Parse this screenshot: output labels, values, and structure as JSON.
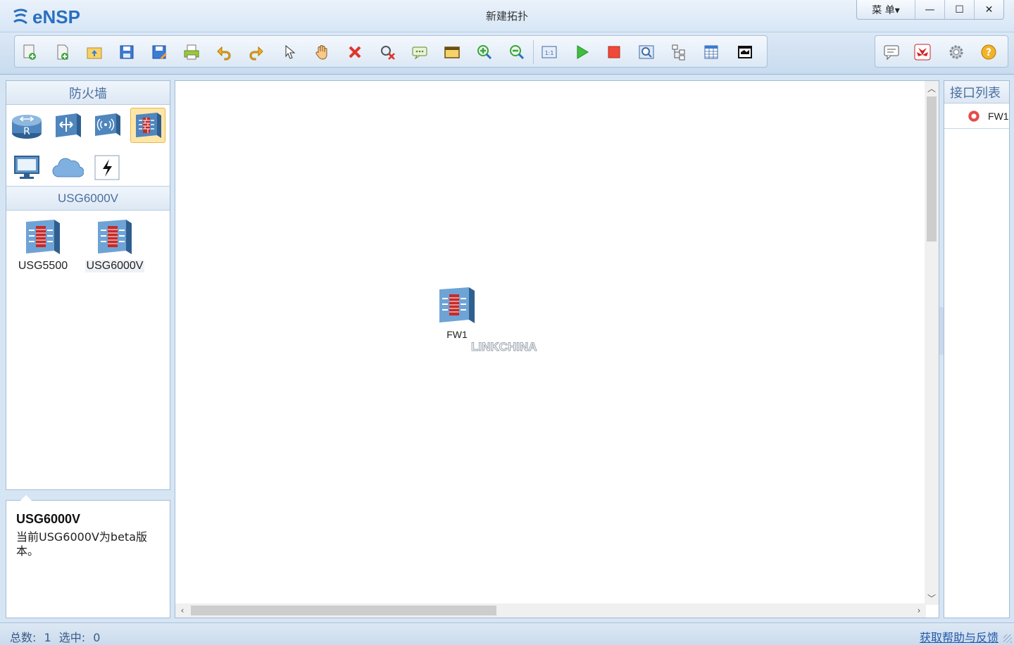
{
  "app": {
    "logo_text": "eNSP",
    "window_title": "新建拓扑"
  },
  "window_controls": {
    "menu_label": "菜 单▾",
    "minimize": "—",
    "maximize": "☐",
    "close": "✕"
  },
  "toolbar": {
    "buttons": [
      "new-topology-icon",
      "new-blank-icon",
      "open-icon",
      "save-icon",
      "save-as-icon",
      "print-icon",
      "undo-icon",
      "redo-icon",
      "select-pointer-icon",
      "pan-hand-icon",
      "delete-icon",
      "delete-link-icon",
      "add-text-icon",
      "palette-icon",
      "zoom-in-icon",
      "zoom-out-icon",
      "fit-view-icon",
      "start-device-icon",
      "stop-device-icon",
      "capture-icon",
      "topology-icon",
      "grid-icon",
      "console-icon"
    ],
    "right_buttons": [
      "comment-icon",
      "huawei-icon",
      "settings-gear-icon",
      "help-icon"
    ]
  },
  "left_panel": {
    "category_header": "防火墙",
    "categories": [
      {
        "name": "router-category-icon",
        "selected": false
      },
      {
        "name": "switch-category-icon",
        "selected": false
      },
      {
        "name": "wireless-category-icon",
        "selected": false
      },
      {
        "name": "firewall-category-icon",
        "selected": true
      },
      {
        "name": "pc-category-icon",
        "selected": false
      },
      {
        "name": "cloud-category-icon",
        "selected": false
      },
      {
        "name": "other-device-category-icon",
        "selected": false
      }
    ],
    "sub_header": "USG6000V",
    "devices": [
      {
        "label": "USG5500",
        "selected": false
      },
      {
        "label": "USG6000V",
        "selected": true
      }
    ]
  },
  "info_panel": {
    "title": "USG6000V",
    "description": "当前USG6000V为beta版本。"
  },
  "canvas": {
    "node": {
      "label": "FW1",
      "icon": "firewall-device-icon"
    },
    "watermark": "LINKCHINA"
  },
  "right_panel": {
    "header": "接口列表",
    "interfaces": [
      {
        "label": "FW1",
        "status_color": "#e14b4b"
      }
    ]
  },
  "status_bar": {
    "total_label": "总数:",
    "total_value": "1",
    "selected_label": "选中:",
    "selected_value": "0",
    "help_link": "获取帮助与反馈"
  },
  "colors": {
    "accent": "#2a6fbf",
    "panel_header_text": "#4a6fa0",
    "selected_category": "#fde6a8"
  }
}
